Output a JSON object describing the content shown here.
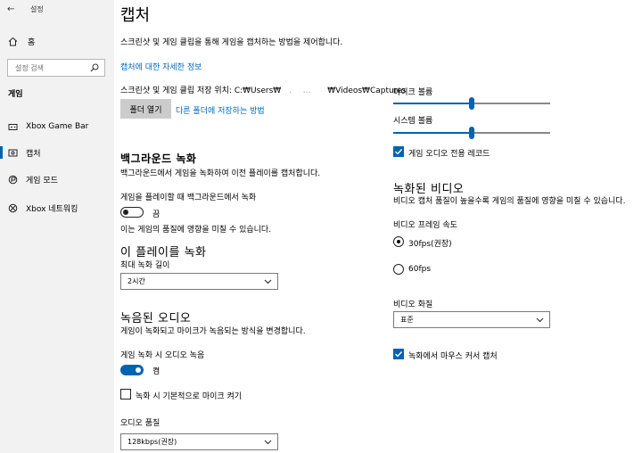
{
  "sidebar": {
    "title": "설정",
    "home": "홈",
    "search_placeholder": "설정 검색",
    "section": "게임",
    "items": [
      {
        "label": "Xbox Game Bar",
        "icon": "xbox-game-bar-icon"
      },
      {
        "label": "캡처",
        "icon": "capture-icon",
        "active": true
      },
      {
        "label": "게임 모드",
        "icon": "game-mode-icon"
      },
      {
        "label": "Xbox 네트워킹",
        "icon": "xbox-icon"
      }
    ]
  },
  "page": {
    "title": "캡처",
    "description": "스크린샷 및 게임 클립을 통해 게임을 캡처하는 방법을 제어합니다.",
    "more_info_link": "캡처에 대한 자세한 정보",
    "save_location_prefix": "스크린샷 및 게임 클립 저장 위치: C:₩Users₩",
    "save_location_suffix": "₩Videos₩Captures",
    "open_folder_button": "폴더 열기",
    "save_elsewhere_link": "다른 폴더에 저장하는 방법"
  },
  "background_recording": {
    "heading": "백그라운드 녹화",
    "description": "백그라운드에서 게임을 녹화하여 이전 플레이를 캡처합니다.",
    "toggle_label": "게임을 플레이할 때 백그라운드에서 녹화",
    "toggle_state": "끔",
    "toggle_on": false,
    "note": "이는 게임의 품질에 영향을 미칠 수 있습니다."
  },
  "record_this": {
    "heading": "이 플레이를 녹화",
    "max_length_label": "최대 녹화 길이",
    "max_length_value": "2시간"
  },
  "recorded_audio": {
    "heading": "녹음된 오디오",
    "description": "게임이 녹화되고 마이크가 녹음되는 방식을 변경합니다.",
    "toggle_label": "게임 녹화 시 오디오 녹음",
    "toggle_state": "켬",
    "toggle_on": true,
    "mic_checkbox_label": "녹화 시 기본적으로 마이크 켜기",
    "mic_checked": false,
    "quality_label": "오디오 품질",
    "quality_value": "128kbps(권장)"
  },
  "volumes": {
    "mic_label": "마이크 볼륨",
    "mic_level": 0.5,
    "system_label": "시스템 볼륨",
    "system_level": 0.5,
    "game_audio_only_label": "게임 오디오 전용 레코드",
    "game_audio_only_checked": true
  },
  "recorded_video": {
    "heading": "녹화된 비디오",
    "description": "비디오 캡처 품질이 높을수록 게임의 품질에 영향을 미칠 수 있습니다.",
    "frame_rate_label": "비디오 프레임 속도",
    "fps30": "30fps(권장)",
    "fps60": "60fps",
    "fps_selected": "30fps(권장)",
    "quality_label": "비디오 화질",
    "quality_value": "표준",
    "cursor_label": "녹화에서 마우스 커서 캡처",
    "cursor_checked": true
  },
  "colors": {
    "accent": "#0063b1",
    "link": "#0067b8",
    "sidebar_bg": "#f2f2f2"
  }
}
